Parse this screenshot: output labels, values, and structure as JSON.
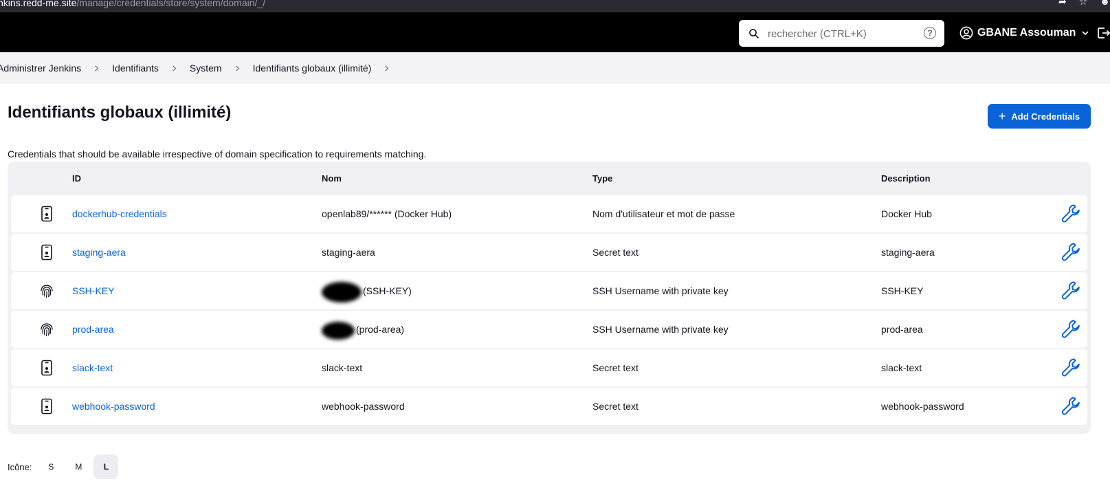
{
  "browser": {
    "url_host": "nkins.redd-me.site",
    "url_path": "/manage/credentials/store/system/domain/_/"
  },
  "header": {
    "search_placeholder": "rechercher (CTRL+K)",
    "help": "?",
    "user_name": "GBANE Assouman"
  },
  "breadcrumbs": [
    "Administrer Jenkins",
    "Identifiants",
    "System",
    "Identifiants globaux (illimité)"
  ],
  "page": {
    "title": "Identifiants globaux (illimité)",
    "add_button": "Add Credentials",
    "description": "Credentials that should be available irrespective of domain specification to requirements matching."
  },
  "table": {
    "headers": {
      "id": "ID",
      "name": "Nom",
      "type": "Type",
      "description": "Description"
    },
    "rows": [
      {
        "icon": "phone-id-icon",
        "id": "dockerhub-credentials",
        "name_visible": "openlab89/****** (Docker Hub)",
        "redacted": false,
        "type": "Nom d'utilisateur et mot de passe",
        "description": "Docker Hub"
      },
      {
        "icon": "phone-id-icon",
        "id": "staging-aera",
        "name_visible": "staging-aera",
        "redacted": false,
        "type": "Secret text",
        "description": "staging-aera"
      },
      {
        "icon": "fingerprint-icon",
        "id": "SSH-KEY",
        "name_visible": "(SSH-KEY)",
        "redacted": true,
        "type": "SSH Username with private key",
        "description": "SSH-KEY"
      },
      {
        "icon": "fingerprint-icon",
        "id": "prod-area",
        "name_visible": "(prod-area)",
        "redacted": true,
        "type": "SSH Username with private key",
        "description": "prod-area"
      },
      {
        "icon": "phone-id-icon",
        "id": "slack-text",
        "name_visible": "slack-text",
        "redacted": false,
        "type": "Secret text",
        "description": "slack-text"
      },
      {
        "icon": "phone-id-icon",
        "id": "webhook-password",
        "name_visible": "webhook-password",
        "redacted": false,
        "type": "Secret text",
        "description": "webhook-password"
      }
    ]
  },
  "icon_size": {
    "label": "Icône:",
    "options": [
      "S",
      "M",
      "L"
    ],
    "selected": "L"
  },
  "colors": {
    "accent": "#0b63d8",
    "header_bg": "#000000",
    "breadcrumb_bg": "#f3f3f6"
  }
}
